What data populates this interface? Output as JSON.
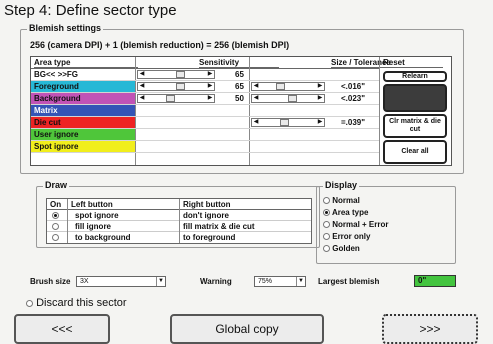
{
  "title": "Step 4: Define sector type",
  "blemish": {
    "legend": "Blemish settings",
    "formula": "256 (camera DPI) + 1 (blemish reduction) = 256 (blemish DPI)",
    "headers": {
      "area": "Area type",
      "sensitivity": "Sensitivity",
      "size": "Size / Tolerance",
      "reset": "Reset"
    },
    "rows": [
      {
        "label": "BG<< >>FG",
        "color": "#ffffff",
        "sens": "65",
        "size": ""
      },
      {
        "label": "Foreground",
        "color": "#27b8d6",
        "sens": "65",
        "size": "<.016\""
      },
      {
        "label": "Background",
        "color": "#c153b6",
        "sens": "50",
        "size": "<.023\""
      },
      {
        "label": "Matrix",
        "color": "#3454b6",
        "sens": "",
        "size": ""
      },
      {
        "label": "Die cut",
        "color": "#ee2323",
        "sens": "",
        "size": "=.039\""
      },
      {
        "label": "User ignore",
        "color": "#4fc63a",
        "sens": "",
        "size": ""
      },
      {
        "label": "Spot ignore",
        "color": "#f1ee1c",
        "sens": "",
        "size": ""
      }
    ],
    "buttons": {
      "relearn": "Relearn",
      "clr_matrix": "Clr matrix & die cut",
      "clear_all": "Clear all"
    }
  },
  "draw": {
    "legend": "Draw",
    "headers": {
      "on": "On",
      "left": "Left button",
      "right": "Right button"
    },
    "rows": [
      {
        "left": "spot ignore",
        "right": "don't ignore",
        "on": true
      },
      {
        "left": "fill ignore",
        "right": "fill matrix & die cut",
        "on": false
      },
      {
        "left": "to background",
        "right": "to foreground",
        "on": false
      }
    ]
  },
  "display": {
    "legend": "Display",
    "options": [
      {
        "label": "Normal",
        "on": false
      },
      {
        "label": "Area type",
        "on": true
      },
      {
        "label": "Normal + Error",
        "on": false
      },
      {
        "label": "Error only",
        "on": false
      },
      {
        "label": "Golden",
        "on": false
      }
    ]
  },
  "bottom": {
    "brush_label": "Brush size",
    "brush_value": "3X",
    "warning_label": "Warning",
    "warning_value": "75%",
    "largest_label": "Largest blemish",
    "largest_value": "0\"",
    "discard": "Discard this sector"
  },
  "nav": {
    "prev": "<<<",
    "global": "Global copy",
    "next": ">>>"
  }
}
